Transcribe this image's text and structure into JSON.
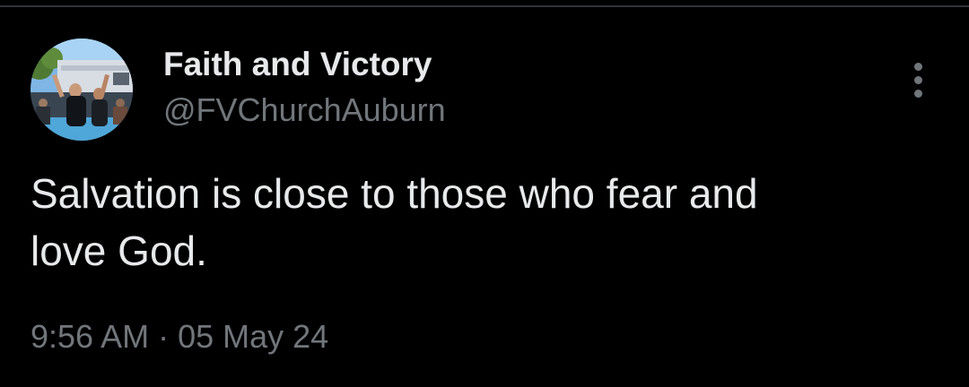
{
  "author": {
    "display_name": "Faith and Victory",
    "handle": "@FVChurchAuburn",
    "avatar_icon": "profile-photo"
  },
  "tweet": {
    "text": "Salvation is close to those who fear and\nlove God.",
    "time": "9:56 AM",
    "separator": "·",
    "date": "05 May 24"
  },
  "menu": {
    "icon": "more-options-icon"
  },
  "colors": {
    "background": "#000000",
    "primary_text": "#e7e9ea",
    "secondary_text": "#71767b",
    "divider": "#2f3336"
  }
}
